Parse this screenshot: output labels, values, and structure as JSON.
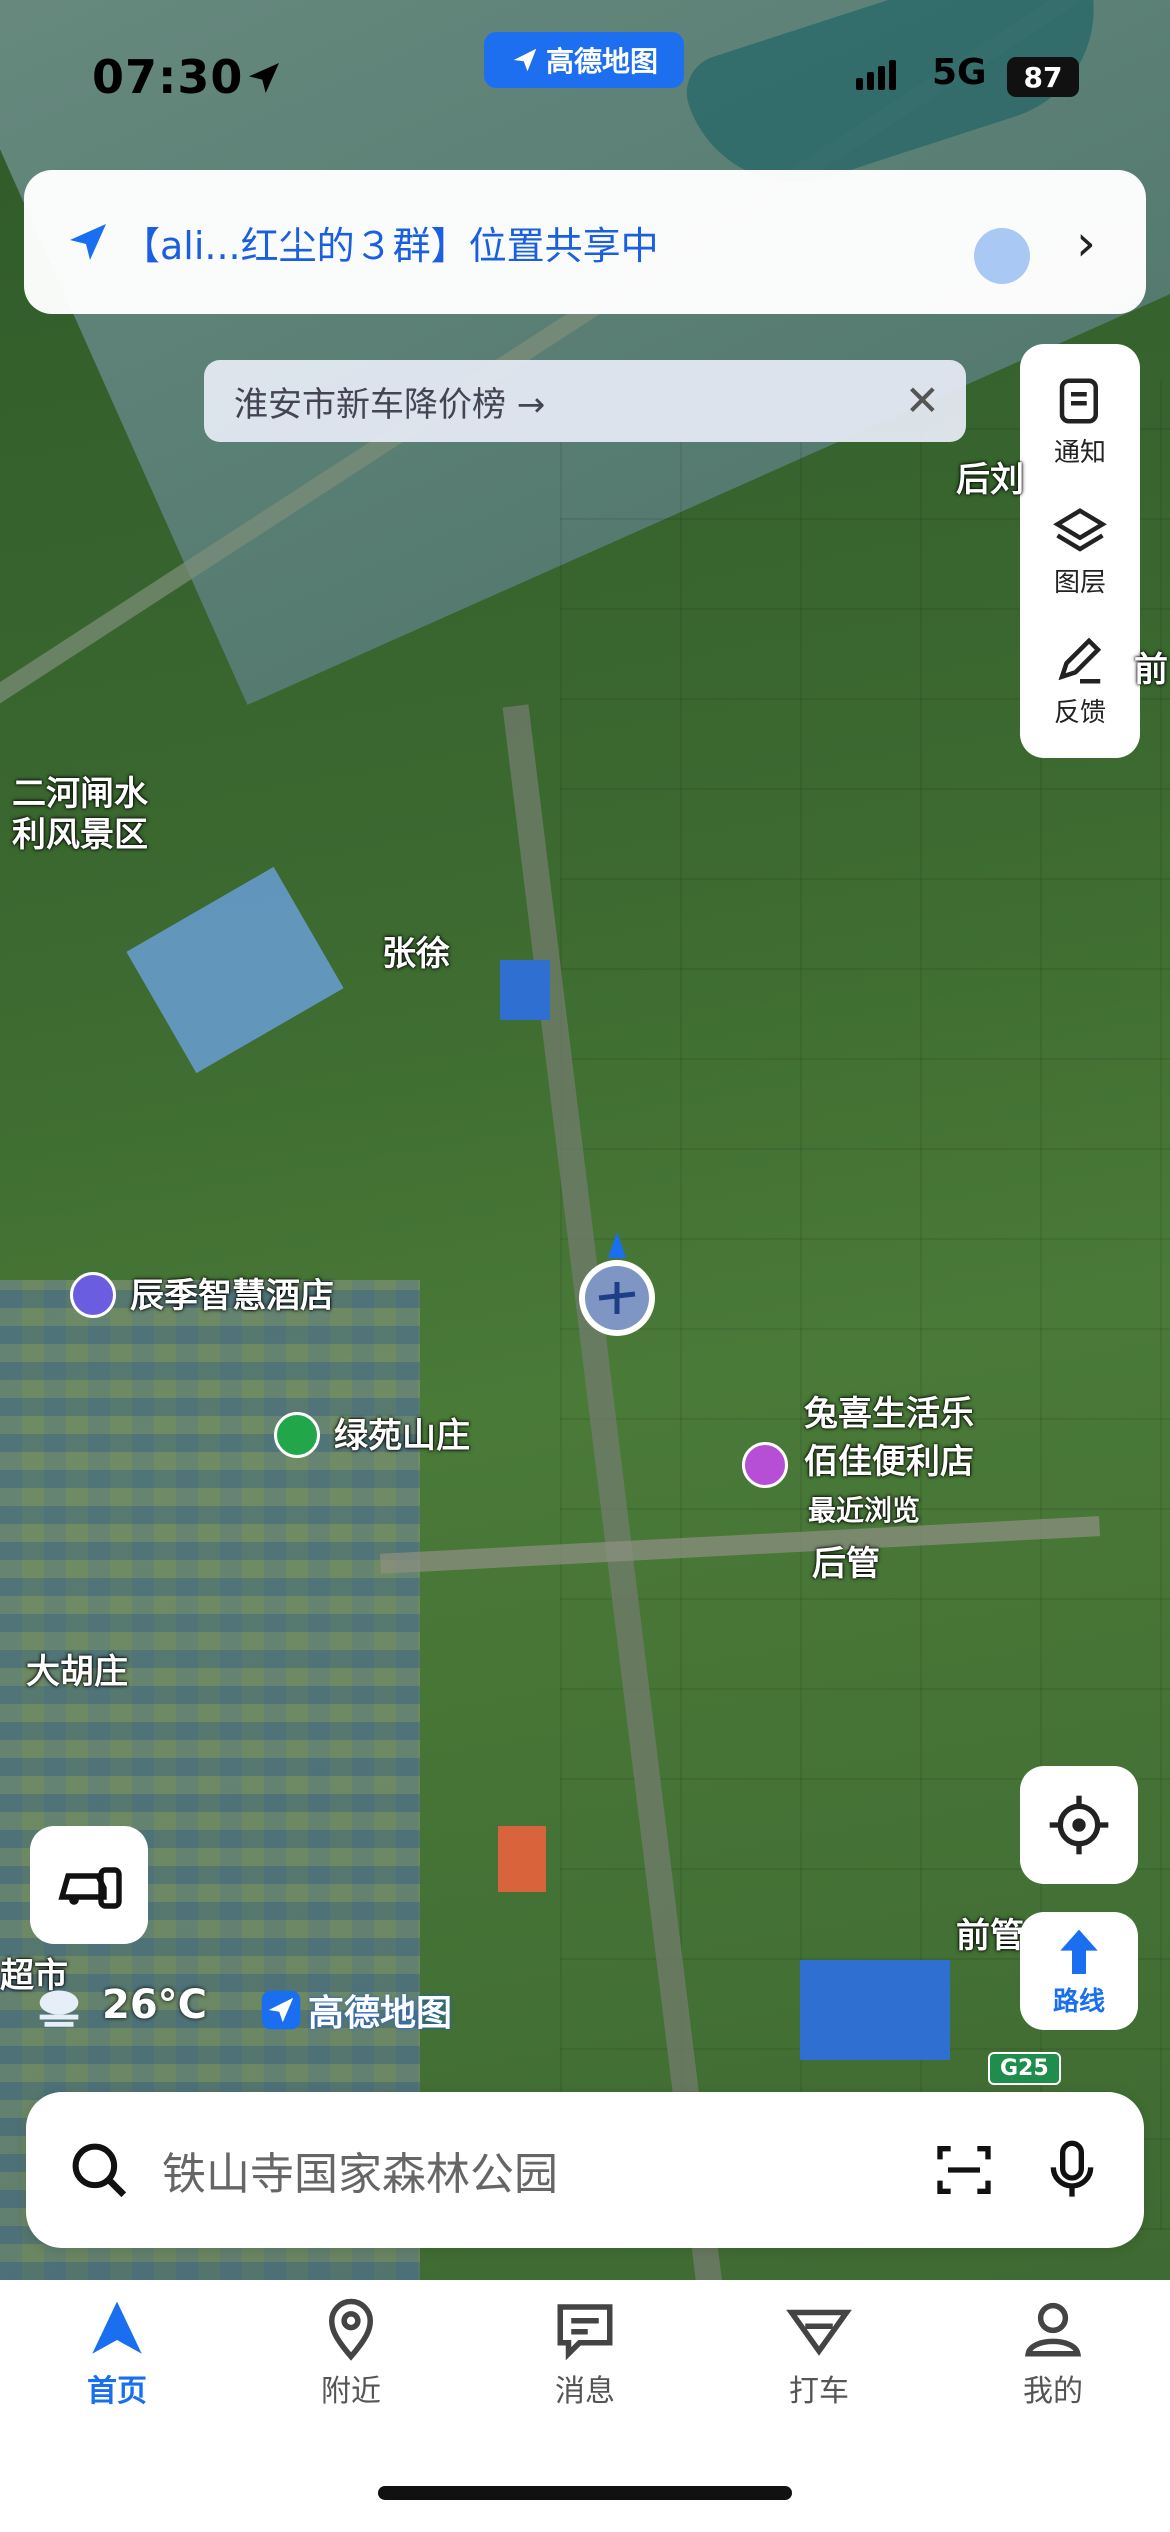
{
  "status": {
    "time": "07:30",
    "network": "5G",
    "battery": "87"
  },
  "app_badge": "高德地图",
  "share": {
    "text": "【ali...红尘的３群】位置共享中"
  },
  "promo": {
    "text": "淮安市新车降价榜 →"
  },
  "tools": [
    {
      "label": "通知",
      "icon": "notice-icon"
    },
    {
      "label": "图层",
      "icon": "layers-icon"
    },
    {
      "label": "反馈",
      "icon": "feedback-edit-icon"
    }
  ],
  "map_labels": {
    "scenic": "二河闸水\n利风景区",
    "zhangxu": "张徐",
    "hotel": "辰季智慧酒店",
    "villa": "绿苑山庄",
    "store_line1": "兔喜生活乐",
    "store_line2": "佰佳便利店",
    "recent": "最近浏览",
    "houguan": "后管",
    "dahuzhuang": "大胡庄",
    "houliu": "后刘",
    "qian": "前",
    "qianguan": "前管",
    "chaoshi": "超市"
  },
  "weather": {
    "temp": "26°C"
  },
  "watermark": "高德地图",
  "road_badge": "G25",
  "route_label": "路线",
  "search": {
    "placeholder": "铁山寺国家森林公园"
  },
  "tabs": [
    {
      "label": "首页",
      "icon": "home-arrow-icon",
      "active": true
    },
    {
      "label": "附近",
      "icon": "location-pin-icon"
    },
    {
      "label": "消息",
      "icon": "message-icon"
    },
    {
      "label": "打车",
      "icon": "taxi-icon"
    },
    {
      "label": "我的",
      "icon": "profile-icon"
    }
  ],
  "colors": {
    "accent": "#1a6ff0",
    "hotel_dot": "#6b5de0",
    "villa_dot": "#22a64a",
    "store_dot": "#b64fd6"
  }
}
